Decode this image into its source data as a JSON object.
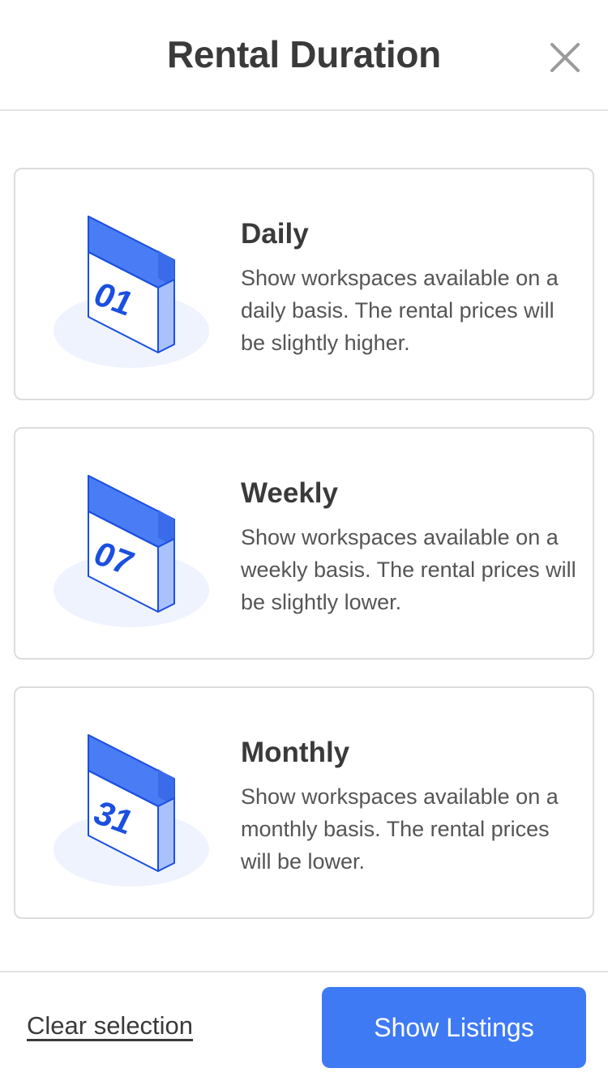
{
  "header": {
    "title": "Rental Duration",
    "close_icon": "close-icon"
  },
  "options": [
    {
      "title": "Daily",
      "day_number": "01",
      "description": "Show workspaces available on a daily basis. The rental prices will be slightly higher.",
      "icon": "calendar-icon"
    },
    {
      "title": "Weekly",
      "day_number": "07",
      "description": "Show workspaces available on a weekly basis. The rental prices will be slightly lower.",
      "icon": "calendar-icon"
    },
    {
      "title": "Monthly",
      "day_number": "31",
      "description": "Show workspaces available on a monthly basis. The rental prices will be lower.",
      "icon": "calendar-icon"
    }
  ],
  "footer": {
    "clear_label": "Clear selection",
    "show_label": "Show Listings"
  },
  "colors": {
    "accent": "#3f7af5",
    "calendar_blue": "#1a4fe0",
    "calendar_top": "#4a7cf5",
    "calendar_side": "#a9c2fb",
    "shadow": "#eef3fe"
  }
}
